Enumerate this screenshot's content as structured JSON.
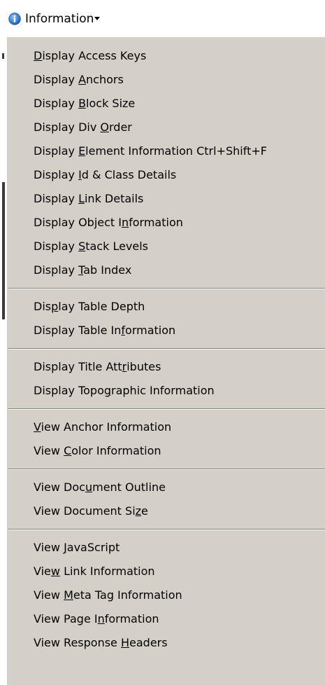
{
  "toolbar": {
    "button_label": "Information",
    "button_icon": "info-icon",
    "icon_color": "#2a7fd6"
  },
  "menu": {
    "background": "#d4d0c8",
    "groups": [
      [
        {
          "pre": "",
          "u": "D",
          "post": "isplay Access Keys"
        },
        {
          "pre": "Display ",
          "u": "A",
          "post": "nchors"
        },
        {
          "pre": "Display ",
          "u": "B",
          "post": "lock Size"
        },
        {
          "pre": "Display Div ",
          "u": "O",
          "post": "rder"
        },
        {
          "pre": "Display ",
          "u": "E",
          "post": "lement Information Ctrl+Shift+F"
        },
        {
          "pre": "Display ",
          "u": "I",
          "post": "d & Class Details"
        },
        {
          "pre": "Display ",
          "u": "L",
          "post": "ink Details"
        },
        {
          "pre": "Display Object I",
          "u": "n",
          "post": "formation"
        },
        {
          "pre": "Display ",
          "u": "S",
          "post": "tack Levels"
        },
        {
          "pre": "Display ",
          "u": "T",
          "post": "ab Index"
        }
      ],
      [
        {
          "pre": "Dis",
          "u": "p",
          "post": "lay Table Depth"
        },
        {
          "pre": "Display Table In",
          "u": "f",
          "post": "ormation"
        }
      ],
      [
        {
          "pre": "Display Title Att",
          "u": "r",
          "post": "ibutes"
        },
        {
          "pre": "Display Topo",
          "u": "g",
          "post": "raphic Information"
        }
      ],
      [
        {
          "pre": "",
          "u": "V",
          "post": "iew Anchor Information"
        },
        {
          "pre": "View ",
          "u": "C",
          "post": "olor Information"
        }
      ],
      [
        {
          "pre": "View Doc",
          "u": "u",
          "post": "ment Outline"
        },
        {
          "pre": "View Document Si",
          "u": "z",
          "post": "e"
        }
      ],
      [
        {
          "pre": "View ",
          "u": "J",
          "post": "avaScript"
        },
        {
          "pre": "Vie",
          "u": "w",
          "post": " Link Information"
        },
        {
          "pre": "View ",
          "u": "M",
          "post": "eta Tag Information"
        },
        {
          "pre": "View Page I",
          "u": "n",
          "post": "formation"
        },
        {
          "pre": "View Response ",
          "u": "H",
          "post": "eaders"
        }
      ]
    ]
  }
}
